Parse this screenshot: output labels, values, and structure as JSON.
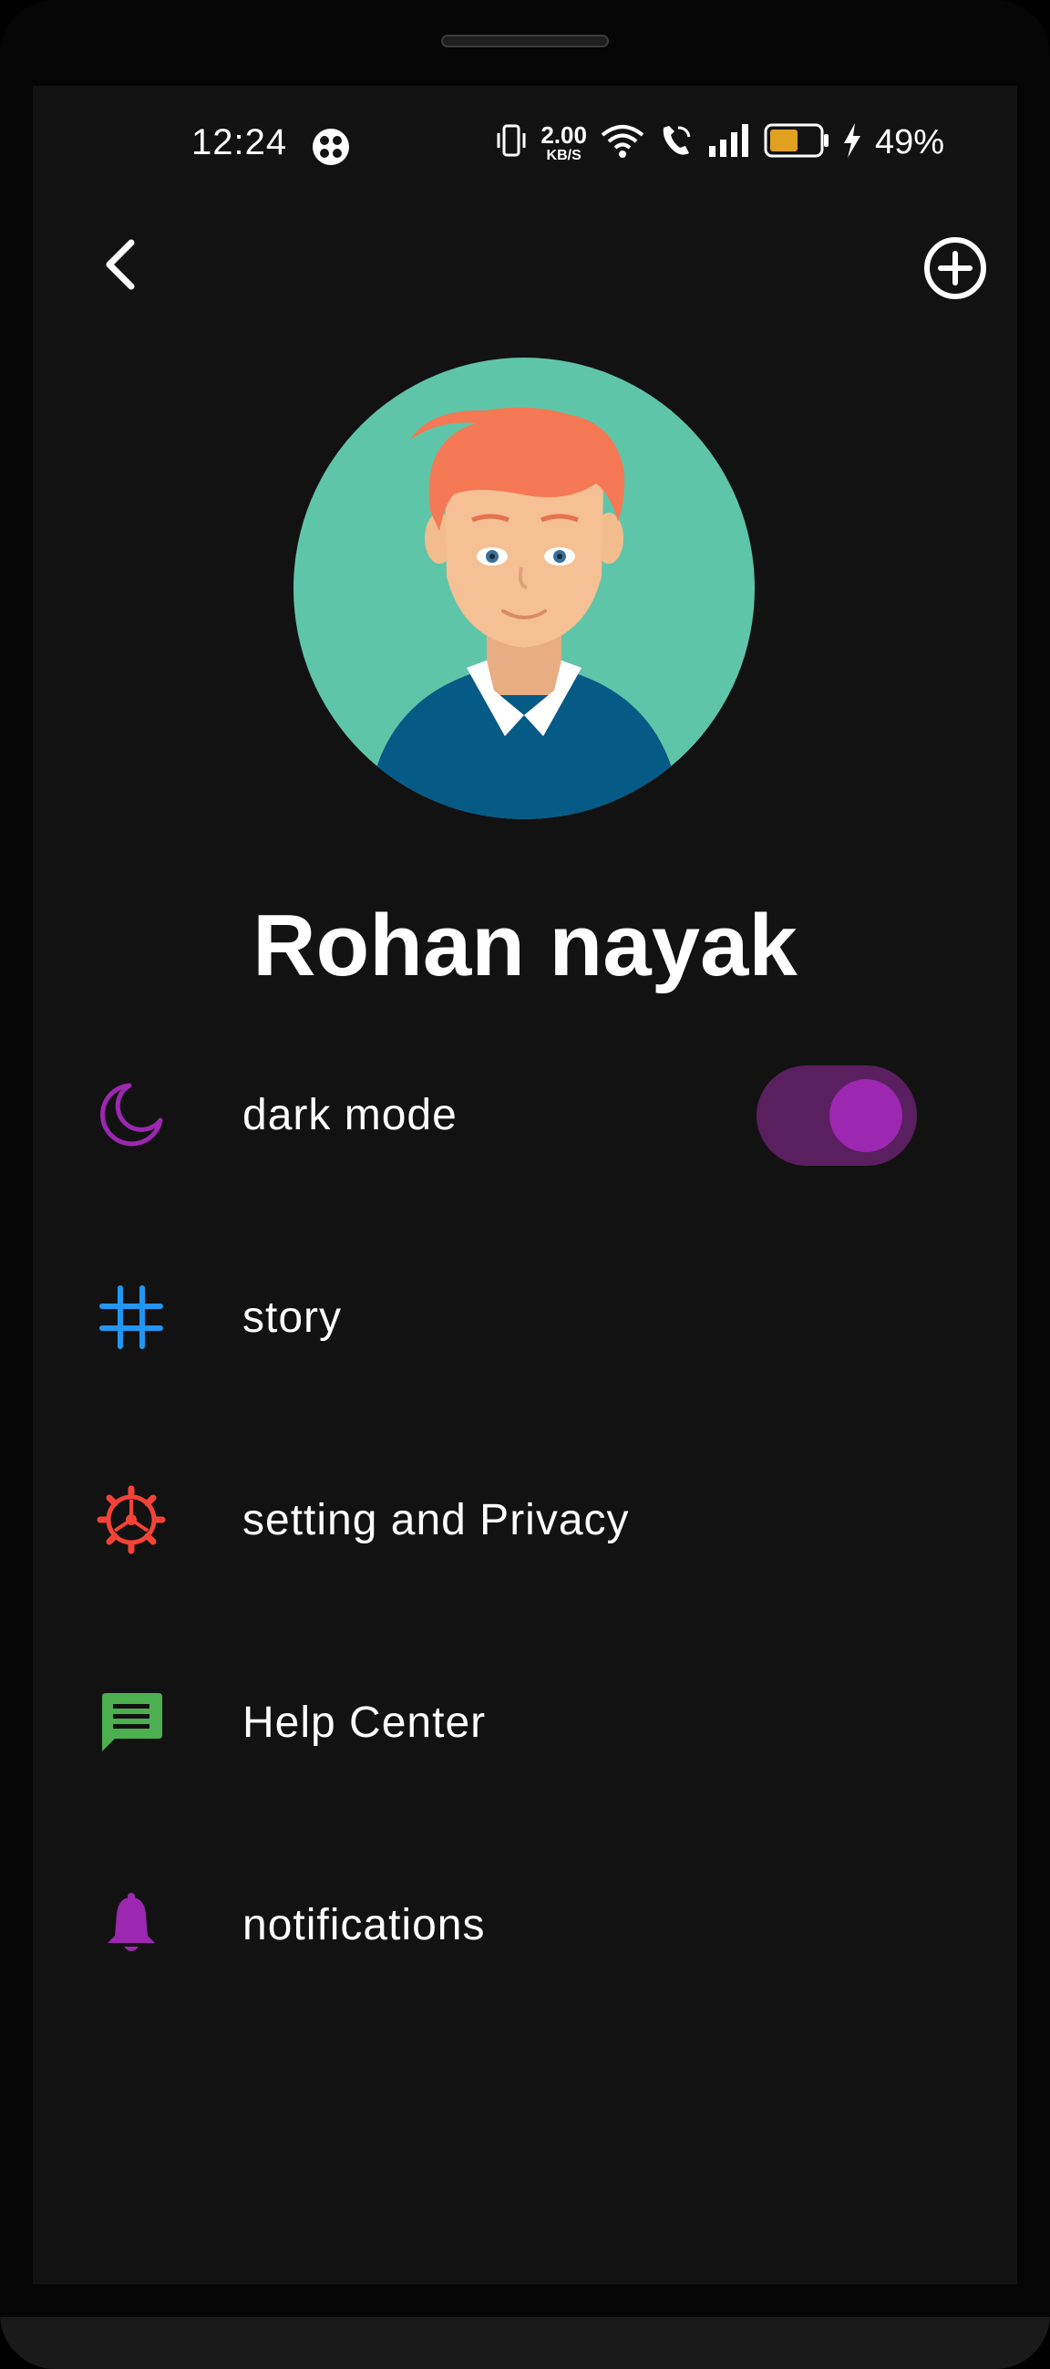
{
  "status_bar": {
    "time": "12:24",
    "net_speed_value": "2.00",
    "net_speed_unit": "KB/S",
    "battery_percent": "49%",
    "icons": [
      "app-notification-icon",
      "vibrate-icon",
      "wifi-icon",
      "wifi-call-icon",
      "signal-icon",
      "battery-icon",
      "charging-icon"
    ]
  },
  "header": {
    "back_icon": "chevron-left-icon",
    "add_icon": "add-circle-icon"
  },
  "profile": {
    "name": "Rohan nayak",
    "avatar_icon": "avatar-illustration"
  },
  "menu": {
    "dark_mode": {
      "label": "dark mode",
      "icon": "moon-icon",
      "color": "#9c27b0",
      "toggle_on": true
    },
    "story": {
      "label": "story",
      "icon": "hashtag-icon",
      "color": "#2196f3"
    },
    "settings": {
      "label": "setting and Privacy",
      "icon": "gear-icon",
      "color": "#f44336"
    },
    "help": {
      "label": "Help Center",
      "icon": "chat-icon",
      "color": "#4caf50"
    },
    "notifications": {
      "label": "notifications",
      "icon": "bell-icon",
      "color": "#9c27b0"
    }
  },
  "colors": {
    "screen_background": "#121212",
    "toggle_track": "#5a1f5e",
    "toggle_knob": "#9c27b0",
    "avatar_background": "#5fc5a9"
  }
}
